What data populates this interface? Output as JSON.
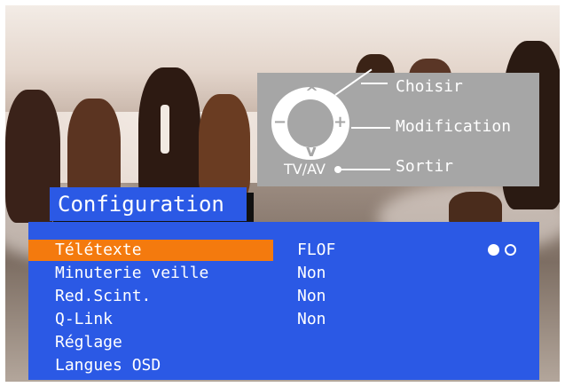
{
  "help": {
    "choose_label": "Choisir",
    "modify_label": "Modification",
    "exit_label": "Sortir",
    "source_button": "TV/AV",
    "up_symbol": "^",
    "down_symbol": "v",
    "minus_symbol": "−",
    "plus_symbol": "+"
  },
  "menu": {
    "title": "Configuration",
    "items": [
      {
        "label": "Télétexte",
        "value": "FLOF",
        "selected": true
      },
      {
        "label": "Minuterie veille",
        "value": "Non"
      },
      {
        "label": "Red.Scint.",
        "value": "Non"
      },
      {
        "label": "Q-Link",
        "value": "Non"
      },
      {
        "label": "Réglage",
        "value": ""
      },
      {
        "label": "Langues OSD",
        "value": ""
      }
    ],
    "option_indicator": [
      "filled",
      "empty"
    ]
  },
  "colors": {
    "menu_background": "#2b59e5",
    "highlight": "#f47a0e",
    "help_panel": "#a6a6a6"
  }
}
